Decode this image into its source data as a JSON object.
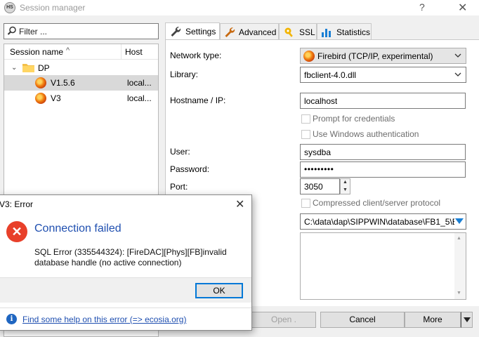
{
  "window": {
    "title": "Session manager",
    "help_glyph": "?",
    "close_glyph": "✕"
  },
  "filter": {
    "placeholder": "Filter ..."
  },
  "session_tree": {
    "columns": {
      "name": "Session name",
      "host": "Host",
      "sort_glyph": "^"
    },
    "folder": {
      "label": "DP",
      "expanded": true
    },
    "sessions": [
      {
        "name": "V1.5.6",
        "host": "local...",
        "selected": true
      },
      {
        "name": "V3",
        "host": "local...",
        "selected": false
      }
    ]
  },
  "tabs": [
    {
      "label": "Settings",
      "icon": "wrench-icon",
      "active": true
    },
    {
      "label": "Advanced",
      "icon": "wrench-icon",
      "active": false
    },
    {
      "label": "SSL",
      "icon": "lock-icon",
      "active": false
    },
    {
      "label": "Statistics",
      "icon": "bar-chart-icon",
      "active": false
    }
  ],
  "settings": {
    "network_type": {
      "label": "Network type:",
      "value": "Firebird (TCP/IP, experimental)"
    },
    "library": {
      "label": "Library:",
      "value": "fbclient-4.0.dll"
    },
    "hostname": {
      "label": "Hostname / IP:",
      "value": "localhost"
    },
    "prompt_credentials": {
      "label": "Prompt for credentials",
      "checked": false
    },
    "windows_auth": {
      "label": "Use Windows authentication",
      "checked": false
    },
    "user": {
      "label": "User:",
      "value": "sysdba"
    },
    "password": {
      "label": "Password:",
      "value": "•••••••••"
    },
    "port": {
      "label": "Port:",
      "value": "3050"
    },
    "compressed": {
      "label": "Compressed client/server protocol",
      "checked": false
    },
    "database": {
      "value": "C:\\data\\dap\\SIPPWIN\\database\\FB1_5\\B"
    },
    "comment": {
      "value": ""
    }
  },
  "buttons": {
    "open": "Open .",
    "cancel": "Cancel",
    "more": "More"
  },
  "error_dialog": {
    "title": "V3: Error",
    "close_glyph": "✕",
    "heading": "Connection failed",
    "message": "SQL Error (335544324): [FireDAC][Phys][FB]invalid database handle (no active connection)",
    "ok_label": "OK",
    "help_link": "Find some help on this error (=> ecosia.org)"
  },
  "colors": {
    "accent": "#0078d7",
    "error": "#e8402a",
    "link": "#1f4fb0"
  }
}
